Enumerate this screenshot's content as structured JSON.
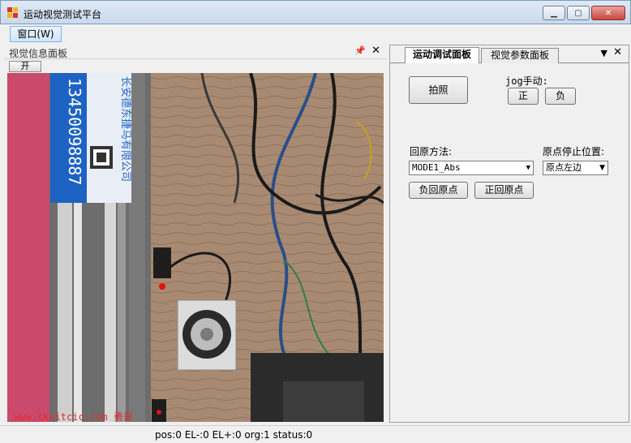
{
  "window": {
    "title": "运动视觉测试平台"
  },
  "menu": {
    "window_label": "窗口(W)"
  },
  "left_panel": {
    "title": "视觉信息面板",
    "open_button": "开"
  },
  "camera": {
    "plate_text": "13450098887",
    "plate_company": "长安德东捷马有限公司",
    "watermark": "www.skeitcic.com 勇哥"
  },
  "right_panel": {
    "tabs": [
      {
        "label": "运动调试面板",
        "active": true
      },
      {
        "label": "视觉参数面板",
        "active": false
      }
    ],
    "photo_button": "拍照",
    "jog_label": "jog手动:",
    "jog_positive": "正",
    "jog_negative": "负",
    "home_method_label": "回原方法:",
    "home_method_value": "MODE1_Abs",
    "home_stop_label": "原点停止位置:",
    "home_stop_value": "原点左边",
    "neg_home_button": "负回原点",
    "pos_home_button": "正回原点"
  },
  "status": {
    "text": "pos:0 EL-:0 EL+:0 org:1 status:0"
  }
}
